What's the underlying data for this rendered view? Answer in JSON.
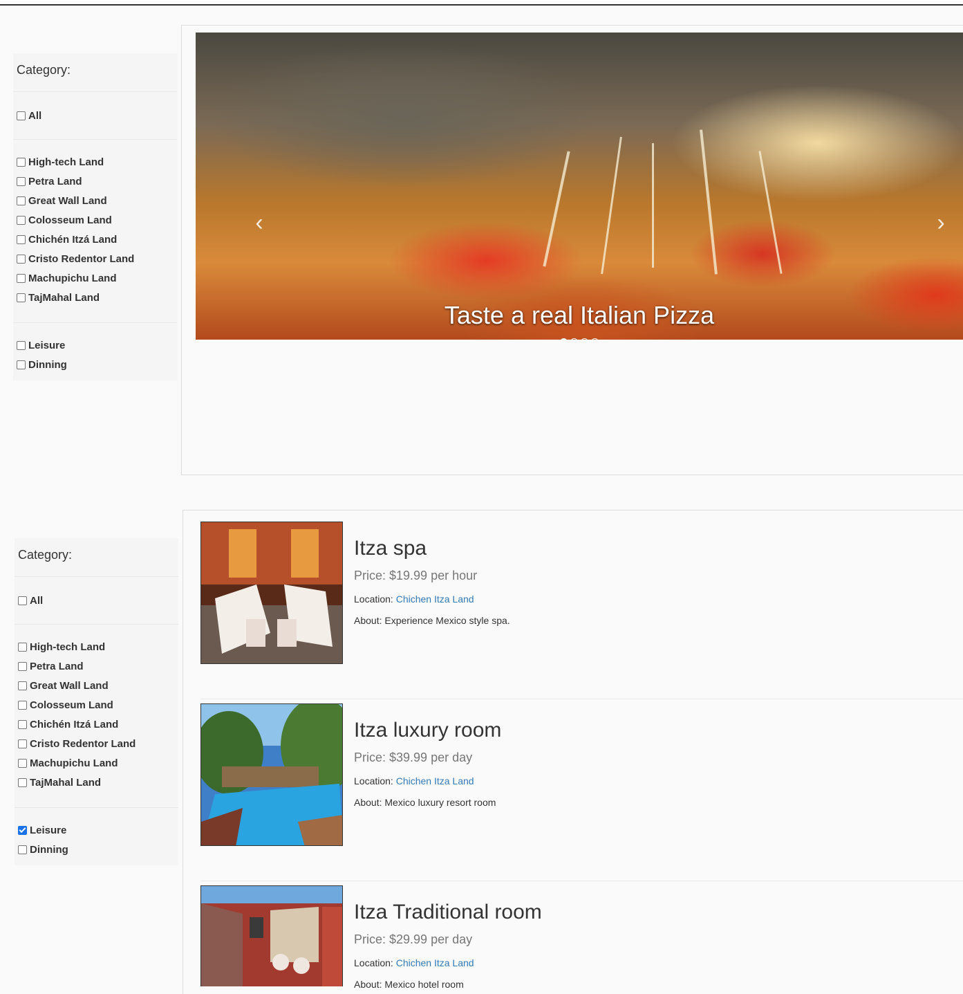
{
  "sidebar_top": {
    "title": "Category:",
    "all": {
      "label": "All",
      "checked": false
    },
    "lands": [
      {
        "label": "High-tech Land",
        "checked": false
      },
      {
        "label": "Petra Land",
        "checked": false
      },
      {
        "label": "Great Wall Land",
        "checked": false
      },
      {
        "label": "Colosseum Land",
        "checked": false
      },
      {
        "label": "Chichén Itzá Land",
        "checked": false
      },
      {
        "label": "Cristo Redentor Land",
        "checked": false
      },
      {
        "label": "Machupichu Land",
        "checked": false
      },
      {
        "label": "TajMahal Land",
        "checked": false
      }
    ],
    "types": [
      {
        "label": "Leisure",
        "checked": false
      },
      {
        "label": "Dinning",
        "checked": false
      }
    ]
  },
  "sidebar_bottom": {
    "title": "Category:",
    "all": {
      "label": "All",
      "checked": false
    },
    "lands": [
      {
        "label": "High-tech Land",
        "checked": false
      },
      {
        "label": "Petra Land",
        "checked": false
      },
      {
        "label": "Great Wall Land",
        "checked": false
      },
      {
        "label": "Colosseum Land",
        "checked": false
      },
      {
        "label": "Chichén Itzá Land",
        "checked": false
      },
      {
        "label": "Cristo Redentor Land",
        "checked": false
      },
      {
        "label": "Machupichu Land",
        "checked": false
      },
      {
        "label": "TajMahal Land",
        "checked": false
      }
    ],
    "types": [
      {
        "label": "Leisure",
        "checked": true
      },
      {
        "label": "Dinning",
        "checked": false
      }
    ]
  },
  "carousel": {
    "caption": "Taste a real Italian Pizza",
    "prev_icon": "chevron-left-icon",
    "next_icon": "chevron-right-icon",
    "prev_glyph": "‹",
    "next_glyph": "›",
    "slide_count": 4,
    "active_index": 0
  },
  "items": [
    {
      "title": "Itza spa",
      "price": "Price: $19.99 per hour",
      "location_label": "Location: ",
      "location_link": "Chichen Itza Land",
      "about": "About: Experience Mexico style spa."
    },
    {
      "title": "Itza luxury room",
      "price": "Price: $39.99 per day",
      "location_label": "Location: ",
      "location_link": "Chichen Itza Land",
      "about": "About: Mexico luxury resort room"
    },
    {
      "title": "Itza Traditional room",
      "price": "Price: $29.99 per day",
      "location_label": "Location: ",
      "location_link": "Chichen Itza Land",
      "about": "About: Mexico hotel room"
    }
  ],
  "colors": {
    "link": "#337ab7",
    "checkbox_checked": "#1a73e8"
  }
}
